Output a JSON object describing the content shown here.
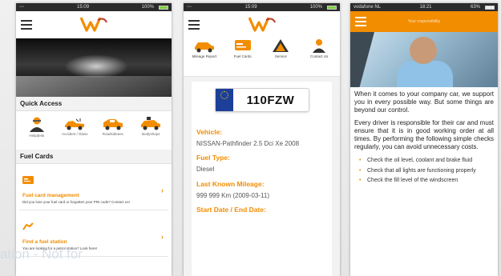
{
  "screens": {
    "home": {
      "status": {
        "time": "15:09",
        "battery": "100%"
      },
      "quick_access": {
        "title": "Quick Access",
        "items": [
          {
            "label": "Helpdesk"
          },
          {
            "label": "Accident / Glass"
          },
          {
            "label": "Roadsideass"
          },
          {
            "label": "Bodyshops"
          }
        ]
      },
      "fuel_cards": {
        "title": "Fuel Cards",
        "cards": [
          {
            "title": "Fuel card management",
            "desc": "Did you lose your fuel card or forgotten your PIN code? Contact us!"
          },
          {
            "title": "Find a fuel station",
            "desc": "You are looking for a petrol station? Look here!"
          }
        ]
      },
      "watermark": "ation - Not for"
    },
    "vehicle": {
      "status": {
        "time": "15:09",
        "battery": "100%"
      },
      "menu": [
        {
          "label": "Mileage Report"
        },
        {
          "label": "Fuel Cards"
        },
        {
          "label": "Service"
        },
        {
          "label": "Contact Us"
        }
      ],
      "plate": "110FZW",
      "fields": [
        {
          "label": "Vehicle:",
          "value": "NISSAN-Pathfinder 2.5 Dci Xe 2008"
        },
        {
          "label": "Fuel Type:",
          "value": "Diesel"
        },
        {
          "label": "Last Known Mileage:",
          "value": "999 999 Km (2009-03-11)"
        },
        {
          "label": "Start Date / End Date:",
          "value": ""
        }
      ]
    },
    "article": {
      "status": {
        "carrier": "vodafone NL",
        "time": "18:21",
        "battery": "63%"
      },
      "title": "Your responsibility",
      "paragraphs": [
        "When it comes to your company car, we support you in every possible way. But some things are beyond our control.",
        "Every driver is responsible for their car and must ensure that it is in good working order at all times. By performing the following simple checks regularly, you can avoid unnecessary costs."
      ],
      "checks": [
        "Check the oil level, coolant and brake fluid",
        "Check that all lights are functioning properly",
        "Check the fill level of the windscreen"
      ]
    }
  },
  "colors": {
    "accent": "#f28d00",
    "eu_blue": "#1c3f9a"
  }
}
